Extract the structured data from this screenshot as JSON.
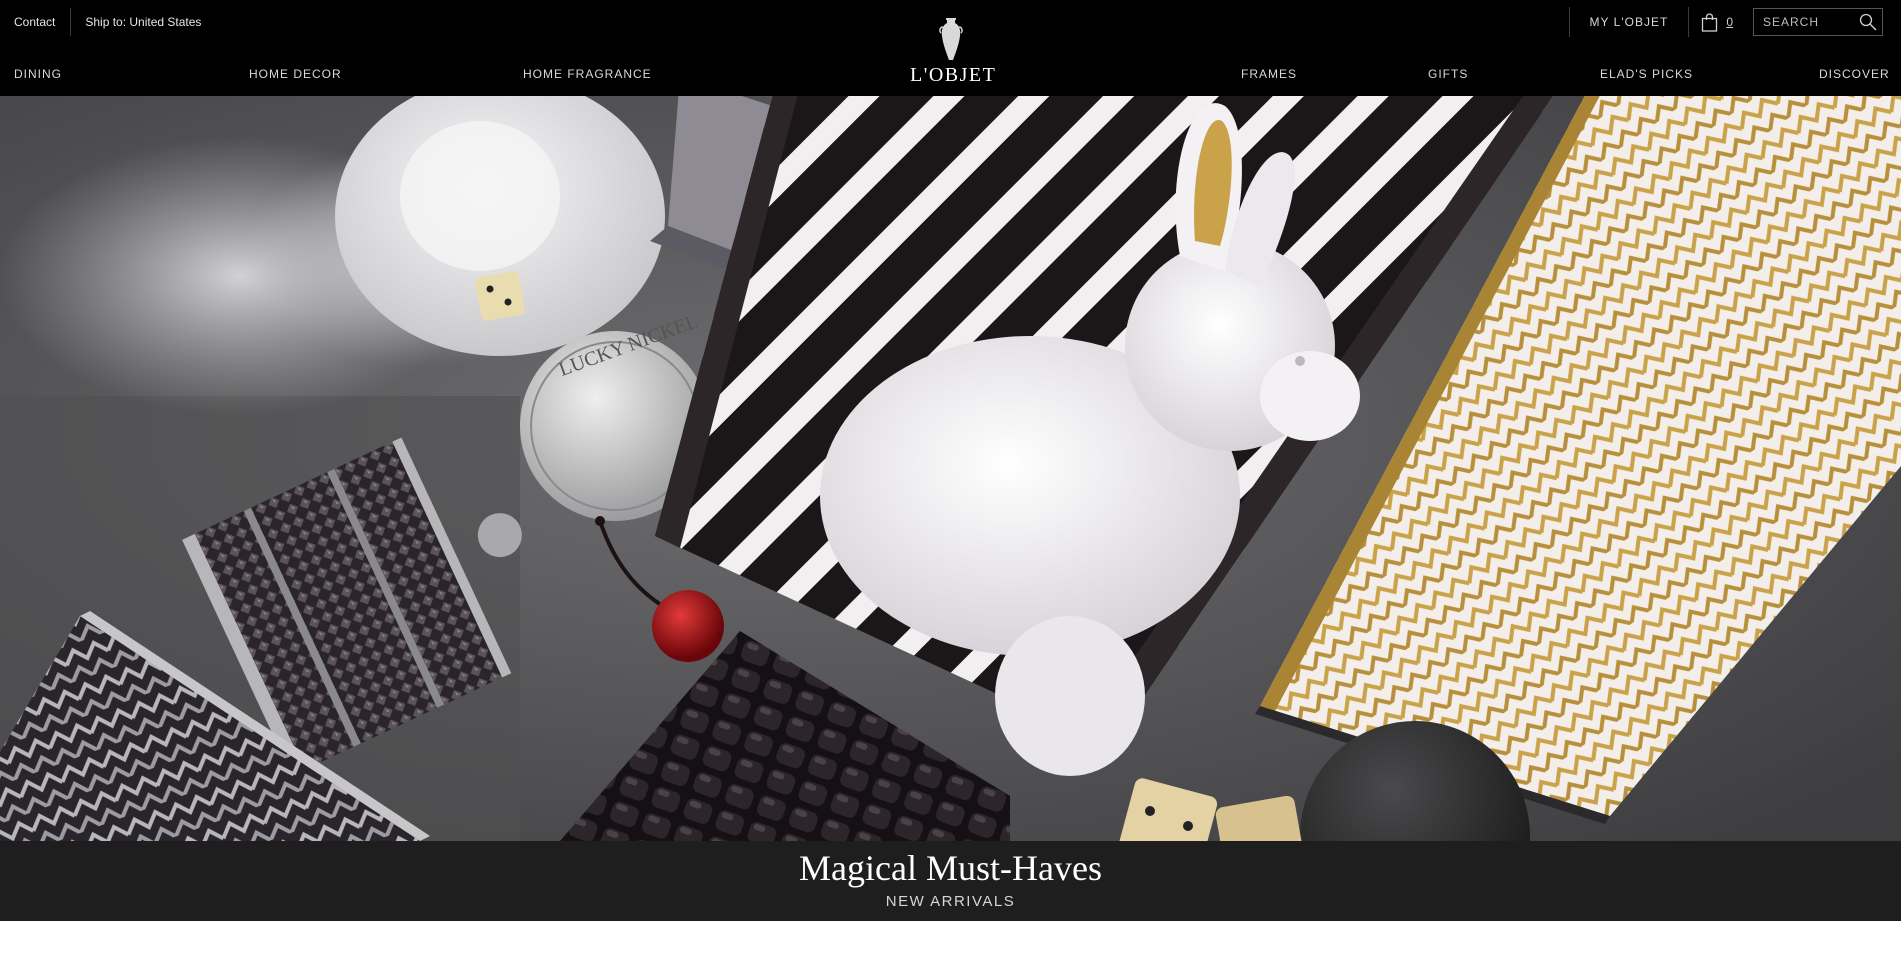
{
  "header": {
    "contact_label": "Contact",
    "ship_to_label": "Ship to: United States",
    "my_account_label": "MY L'OBJET",
    "cart_count": "0",
    "search_placeholder": "SEARCH",
    "logo_text": "L'OBJET",
    "icons": {
      "logo": "amphora-urn-icon",
      "cart": "shopping-bag-icon",
      "search": "magnifier-icon"
    }
  },
  "nav": {
    "items": [
      {
        "label": "DINING"
      },
      {
        "label": "HOME DECOR"
      },
      {
        "label": "HOME FRAGRANCE"
      },
      {
        "label": "FRAMES"
      },
      {
        "label": "GIFTS"
      },
      {
        "label": "ELAD'S PICKS"
      },
      {
        "label": "DISCOVER"
      }
    ]
  },
  "hero": {
    "title": "Magical Must-Haves",
    "subtitle": "NEW ARRIVALS",
    "coin_text": "LUCKY NICKEL"
  },
  "colors": {
    "header_bg": "#000000",
    "caption_band_bg": "#1e1e1e",
    "accent_gold": "#c9a24a"
  }
}
